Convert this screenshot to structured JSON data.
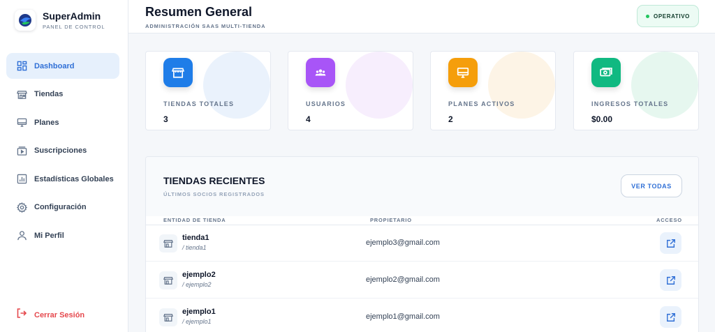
{
  "brand": {
    "title": "SuperAdmin",
    "subtitle": "PANEL DE CONTROL"
  },
  "sidebar": {
    "items": [
      {
        "label": "Dashboard",
        "icon": "dashboard-grid-icon",
        "active": true
      },
      {
        "label": "Tiendas",
        "icon": "store-icon"
      },
      {
        "label": "Planes",
        "icon": "monitor-icon"
      },
      {
        "label": "Suscripciones",
        "icon": "subscriptions-icon"
      },
      {
        "label": "Estadísticas Globales",
        "icon": "bar-chart-icon"
      },
      {
        "label": "Configuración",
        "icon": "gear-icon"
      },
      {
        "label": "Mi Perfil",
        "icon": "user-icon"
      }
    ],
    "logout_label": "Cerrar Sesión"
  },
  "header": {
    "title": "Resumen General",
    "subtitle": "ADMINISTRACIÓN SAAS MULTI-TIENDA",
    "status": "OPERATIVO"
  },
  "stats": [
    {
      "label": "TIENDAS TOTALES",
      "value": "3",
      "color": "#1f7de8",
      "blob": "#eaf2fc",
      "icon": "store-icon"
    },
    {
      "label": "USUARIOS",
      "value": "4",
      "color": "#a855f7",
      "blob": "#f7eefd",
      "icon": "users-icon"
    },
    {
      "label": "PLANES ACTIVOS",
      "value": "2",
      "color": "#f59e0b",
      "blob": "#fdf4e6",
      "icon": "monitor-icon"
    },
    {
      "label": "INGRESOS TOTALES",
      "value": "$0.00",
      "color": "#10b981",
      "blob": "#e6f7ef",
      "icon": "money-icon"
    }
  ],
  "recent": {
    "title": "TIENDAS RECIENTES",
    "subtitle": "ÚLTIMOS SOCIOS REGISTRADOS",
    "view_all": "VER TODAS",
    "columns": [
      "ENTIDAD DE TIENDA",
      "PROPIETARIO",
      "ACCESO"
    ],
    "rows": [
      {
        "name": "tienda1",
        "slug": "/ tienda1",
        "owner": "ejemplo3@gmail.com"
      },
      {
        "name": "ejemplo2",
        "slug": "/ ejemplo2",
        "owner": "ejemplo2@gmail.com"
      },
      {
        "name": "ejemplo1",
        "slug": "/ ejemplo1",
        "owner": "ejemplo1@gmail.com"
      }
    ]
  }
}
